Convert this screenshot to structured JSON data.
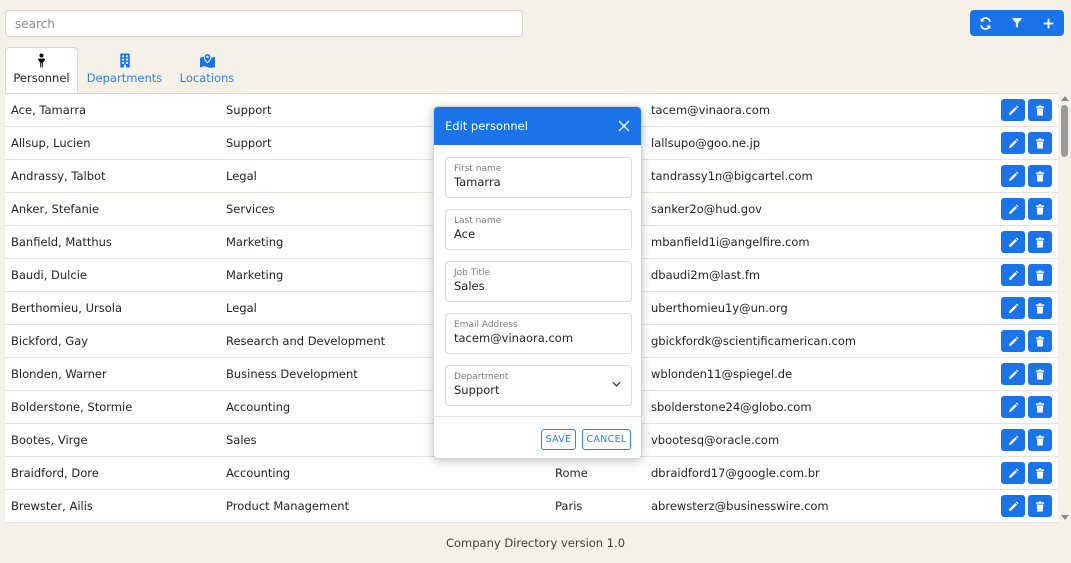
{
  "search": {
    "placeholder": "search",
    "value": ""
  },
  "toolbar": {
    "refresh_icon": "refresh-icon",
    "filter_icon": "filter-icon",
    "add_icon": "plus-icon"
  },
  "tabs": [
    {
      "label": "Personnel",
      "icon": "person-icon",
      "active": true
    },
    {
      "label": "Departments",
      "icon": "building-icon",
      "active": false
    },
    {
      "label": "Locations",
      "icon": "map-pin-icon",
      "active": false
    }
  ],
  "rows": [
    {
      "name": "Ace, Tamarra",
      "department": "Support",
      "location": "",
      "email": "tacem@vinaora.com"
    },
    {
      "name": "Allsup, Lucien",
      "department": "Support",
      "location": "",
      "email": "lallsupo@goo.ne.jp"
    },
    {
      "name": "Andrassy, Talbot",
      "department": "Legal",
      "location": "",
      "email": "tandrassy1n@bigcartel.com"
    },
    {
      "name": "Anker, Stefanie",
      "department": "Services",
      "location": "",
      "email": "sanker2o@hud.gov"
    },
    {
      "name": "Banfield, Matthus",
      "department": "Marketing",
      "location": "",
      "email": "mbanfield1i@angelfire.com"
    },
    {
      "name": "Baudi, Dulcie",
      "department": "Marketing",
      "location": "",
      "email": "dbaudi2m@last.fm"
    },
    {
      "name": "Berthomieu, Ursola",
      "department": "Legal",
      "location": "",
      "email": "uberthomieu1y@un.org"
    },
    {
      "name": "Bickford, Gay",
      "department": "Research and Development",
      "location": "",
      "email": "gbickfordk@scientificamerican.com"
    },
    {
      "name": "Blonden, Warner",
      "department": "Business Development",
      "location": "",
      "email": "wblonden11@spiegel.de"
    },
    {
      "name": "Bolderstone, Stormie",
      "department": "Accounting",
      "location": "",
      "email": "sbolderstone24@globo.com"
    },
    {
      "name": "Bootes, Virge",
      "department": "Sales",
      "location": "",
      "email": "vbootesq@oracle.com"
    },
    {
      "name": "Braidford, Dore",
      "department": "Accounting",
      "location": "Rome",
      "email": "dbraidford17@google.com.br"
    },
    {
      "name": "Brewster, Ailis",
      "department": "Product Management",
      "location": "Paris",
      "email": "abrewsterz@businesswire.com"
    }
  ],
  "footer": {
    "text": "Company Directory version 1.0"
  },
  "modal": {
    "title": "Edit personnel",
    "fields": {
      "first_name": {
        "label": "First name",
        "value": "Tamarra"
      },
      "last_name": {
        "label": "Last name",
        "value": "Ace"
      },
      "job_title": {
        "label": "Job Title",
        "value": "Sales"
      },
      "email": {
        "label": "Email Address",
        "value": "tacem@vinaora.com"
      },
      "department": {
        "label": "Department",
        "value": "Support"
      }
    },
    "save_label": "SAVE",
    "cancel_label": "CANCEL"
  },
  "colors": {
    "primary": "#1a73e8",
    "link": "#2f80ed",
    "background": "#f6f1e8"
  }
}
